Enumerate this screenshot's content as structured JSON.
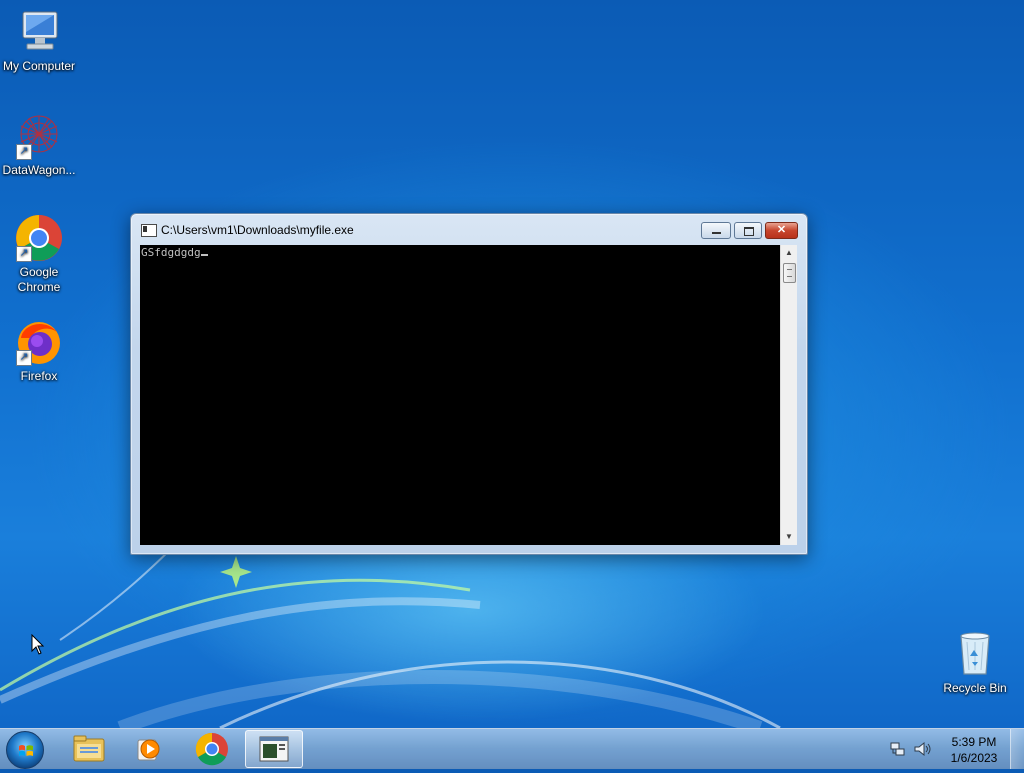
{
  "desktop": {
    "icons": [
      {
        "label": "My Computer",
        "icon": "computer-icon"
      },
      {
        "label": "DataWagon...",
        "icon": "datawagon-icon"
      },
      {
        "label": "Google Chrome",
        "icon": "chrome-icon"
      },
      {
        "label": "Firefox",
        "icon": "firefox-icon"
      },
      {
        "label": "Recycle Bin",
        "icon": "recycle-bin-icon"
      }
    ]
  },
  "window": {
    "title": "C:\\Users\\vm1\\Downloads\\myfile.exe",
    "console_text": "GSfdgdgdg",
    "close_glyph": "✕"
  },
  "taskbar": {
    "items": [
      "start-orb",
      "explorer",
      "media-player",
      "chrome",
      "console"
    ],
    "active_item": "console",
    "clock": {
      "time": "5:39 PM",
      "date": "1/6/2023"
    }
  },
  "colors": {
    "desktop_blue": "#1170cf",
    "console_bg": "#000000",
    "console_fg": "#c0c0c0",
    "close_red": "#c7452d"
  }
}
